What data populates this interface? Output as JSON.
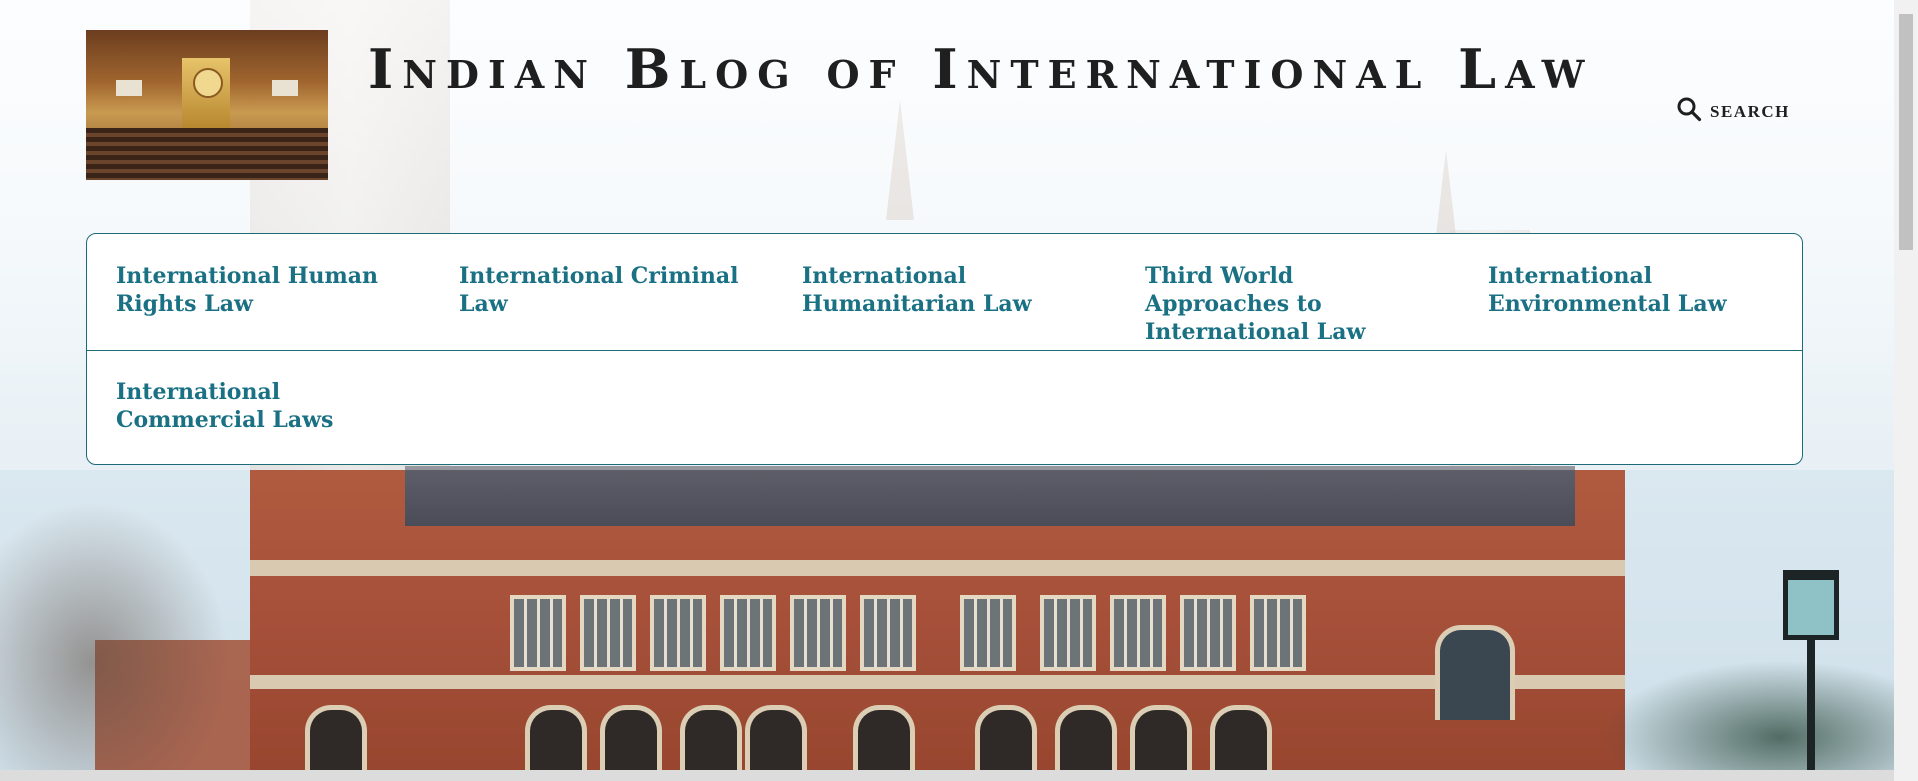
{
  "site": {
    "title": "Indian Blog of International Law"
  },
  "header": {
    "search_label": "Search",
    "search_icon": "magnifier"
  },
  "nav": {
    "items": [
      {
        "label": "International Human Rights Law"
      },
      {
        "label": "International Criminal Law"
      },
      {
        "label": "International Humanitarian Law"
      },
      {
        "label": "Third World Approaches to International Law"
      },
      {
        "label": "International Environmental Law"
      },
      {
        "label": "International Commercial Laws"
      }
    ]
  },
  "colors": {
    "nav_link": "#1b7184",
    "nav_border": "#1e6b78",
    "title": "#1f1f1f"
  }
}
